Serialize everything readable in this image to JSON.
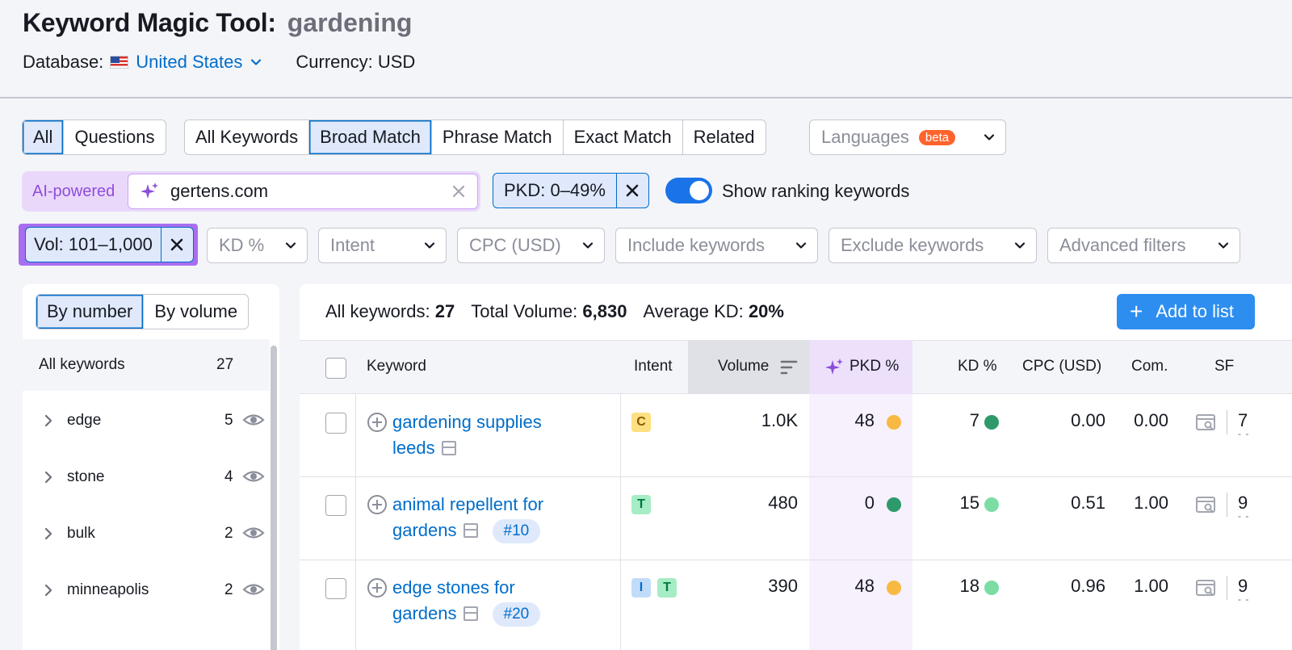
{
  "header": {
    "title": "Keyword Magic Tool:",
    "query": "gardening",
    "database_label": "Database:",
    "database_value": "United States",
    "currency": "Currency: USD"
  },
  "match_tabs": {
    "group1": [
      "All",
      "Questions"
    ],
    "group2": [
      "All Keywords",
      "Broad Match",
      "Phrase Match",
      "Exact Match",
      "Related"
    ],
    "languages_label": "Languages",
    "beta_badge": "beta"
  },
  "ai_filter": {
    "label": "AI-powered",
    "value": "gertens.com"
  },
  "pkd_chip": "PKD: 0–49%",
  "show_ranking": "Show ranking keywords",
  "vol_chip": "Vol: 101–1,000",
  "filters": [
    "KD %",
    "Intent",
    "CPC (USD)",
    "Include keywords",
    "Exclude keywords",
    "Advanced filters"
  ],
  "sidebar": {
    "sort_tabs": [
      "By number",
      "By volume"
    ],
    "all_label": "All keywords",
    "all_count": "27",
    "items": [
      {
        "label": "edge",
        "count": "5"
      },
      {
        "label": "stone",
        "count": "4"
      },
      {
        "label": "bulk",
        "count": "2"
      },
      {
        "label": "minneapolis",
        "count": "2"
      }
    ]
  },
  "stats": {
    "all_label": "All keywords:",
    "all_value": "27",
    "vol_label": "Total Volume:",
    "vol_value": "6,830",
    "kd_label": "Average KD:",
    "kd_value": "20%"
  },
  "add_button": "Add to list",
  "columns": {
    "keyword": "Keyword",
    "intent": "Intent",
    "volume": "Volume",
    "pkd": "PKD %",
    "kd": "KD %",
    "cpc": "CPC (USD)",
    "com": "Com.",
    "sf": "SF"
  },
  "rows": [
    {
      "kw_line1": "gardening supplies",
      "kw_line2": "leeds",
      "rank": "",
      "intents": [
        {
          "l": "C",
          "bg": "#fce081",
          "fg": "#8a5a00"
        }
      ],
      "volume": "1.0K",
      "pkd": "48",
      "pkd_color": "#f7b941",
      "kd": "7",
      "kd_color": "#2e9a6c",
      "cpc": "0.00",
      "com": "0.00",
      "sf": "7"
    },
    {
      "kw_line1": "animal repellent for",
      "kw_line2": "gardens",
      "rank": "#10",
      "intents": [
        {
          "l": "T",
          "bg": "#a6ecc4",
          "fg": "#00773e"
        }
      ],
      "volume": "480",
      "pkd": "0",
      "pkd_color": "#2e9a6c",
      "kd": "15",
      "kd_color": "#7cdda4",
      "cpc": "0.51",
      "com": "1.00",
      "sf": "9"
    },
    {
      "kw_line1": "edge stones for",
      "kw_line2": "gardens",
      "rank": "#20",
      "intents": [
        {
          "l": "I",
          "bg": "#c1dcf9",
          "fg": "#006dca"
        },
        {
          "l": "T",
          "bg": "#a6ecc4",
          "fg": "#00773e"
        }
      ],
      "volume": "390",
      "pkd": "48",
      "pkd_color": "#f7b941",
      "kd": "18",
      "kd_color": "#7cdda4",
      "cpc": "0.96",
      "com": "1.00",
      "sf": "9"
    }
  ]
}
